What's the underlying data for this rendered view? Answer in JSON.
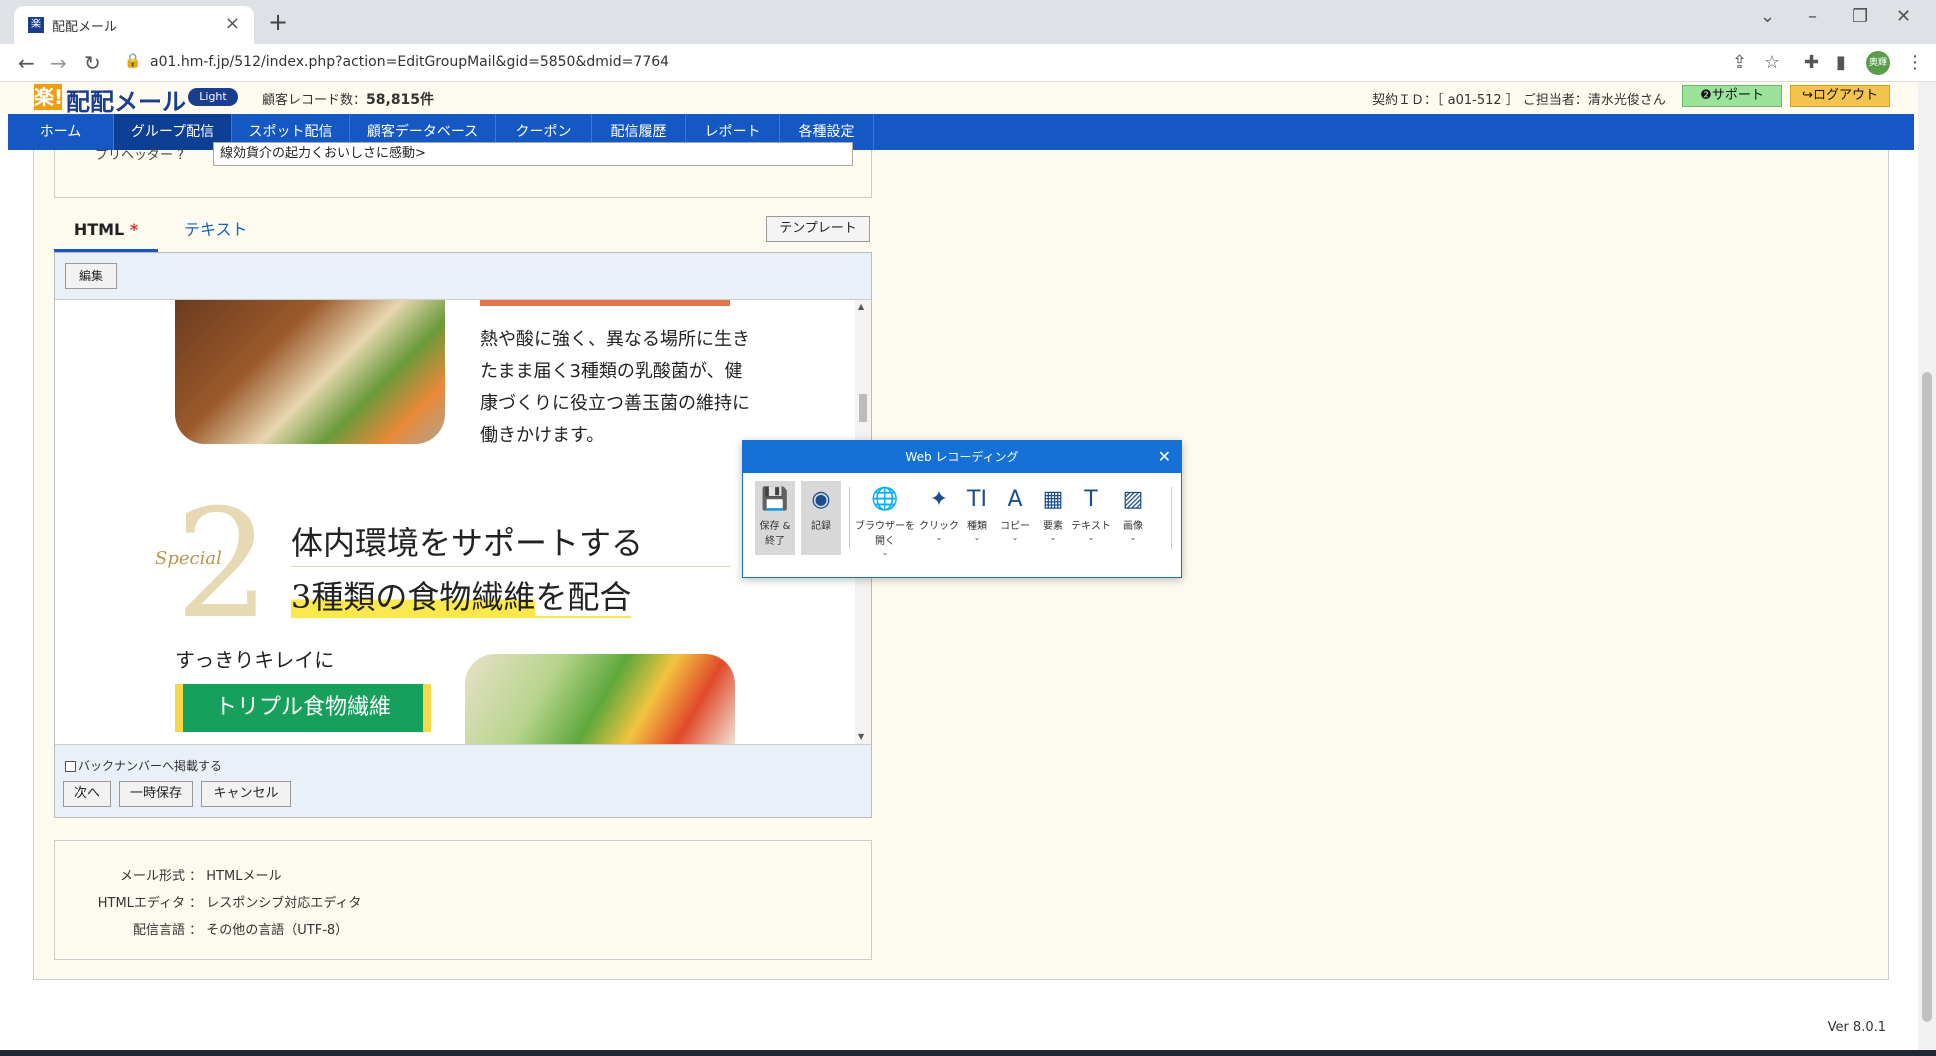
{
  "browser": {
    "tab_title": "配配メール",
    "tab_favicon": "楽",
    "url": "a01.hm-f.jp/512/index.php?action=EditGroupMail&gid=5850&dmid=7764",
    "profile_initials": "奥輝"
  },
  "header": {
    "logo_mark": "楽!",
    "logo_text": "配配メール",
    "edition_badge": "Light",
    "record_label": "顧客レコード数：",
    "record_count": "58,815件",
    "contract_info": "契約ＩＤ：［ a01-512 ］ ご担当者：清水光俊さん",
    "support_label": "❷サポート",
    "logout_label": "↪ログアウト"
  },
  "nav": {
    "items": [
      {
        "label": "ホーム"
      },
      {
        "label": "グループ配信"
      },
      {
        "label": "スポット配信"
      },
      {
        "label": "顧客データベース"
      },
      {
        "label": "クーポン"
      },
      {
        "label": "配信履歴"
      },
      {
        "label": "レポート"
      },
      {
        "label": "各種設定"
      }
    ],
    "active_index": 1
  },
  "form": {
    "preheader_label": "プリヘッダー ?",
    "preheader_value": "線効貨介の起力くおいしさに感動>",
    "tab_html": "HTML",
    "tab_html_required": "*",
    "tab_text": "テキスト",
    "template_button": "テンプレート",
    "edit_button": "編集",
    "backnumber_checkbox": "バックナンバーへ掲載する",
    "next_button": "次へ",
    "save_temp_button": "一時保存",
    "cancel_button": "キャンセル"
  },
  "preview": {
    "miso_text": "熱や酸に強く、異なる場所に生きたまま届く3種類の乳酸菌が、健康づくりに役立つ善玉菌の維持に働きかけます。",
    "special_label": "Special",
    "special_number": "2",
    "headline1": "体内環境をサポートする",
    "headline2_main": "3種類の食物繊維",
    "headline2_tail": "を配合",
    "kirei_text": "すっきりキレイに",
    "triple_label": "トリプル食物繊維"
  },
  "info": {
    "rows": [
      {
        "label": "メール形式",
        "value": "HTMLメール"
      },
      {
        "label": "HTMLエディタ",
        "value": "レスポンシブ対応エディタ"
      },
      {
        "label": "配信言語",
        "value": "その他の言語（UTF-8）"
      }
    ]
  },
  "version": "Ver 8.0.1",
  "recorder": {
    "title": "Web レコーディング",
    "tools": [
      {
        "label": "保存 & 終了",
        "icon": "save-icon",
        "glyph": "💾"
      },
      {
        "label": "記録",
        "icon": "record-icon",
        "glyph": "◉"
      },
      {
        "label": "ブラウザーを開く",
        "icon": "globe-icon",
        "glyph": "🌐"
      },
      {
        "label": "クリック",
        "icon": "click-icon",
        "glyph": "✦"
      },
      {
        "label": "種類",
        "icon": "type-icon",
        "glyph": "TI"
      },
      {
        "label": "コピー",
        "icon": "copy-icon",
        "glyph": "A"
      },
      {
        "label": "要素",
        "icon": "element-icon",
        "glyph": "▦"
      },
      {
        "label": "テキスト",
        "icon": "text-icon",
        "glyph": "T"
      },
      {
        "label": "画像",
        "icon": "image-icon",
        "glyph": "▨"
      }
    ]
  },
  "colors": {
    "nav_bg": "#1558c3",
    "nav_active": "#0d3f94",
    "recorder_accent": "#1571d6",
    "triple_green": "#16a05b"
  }
}
